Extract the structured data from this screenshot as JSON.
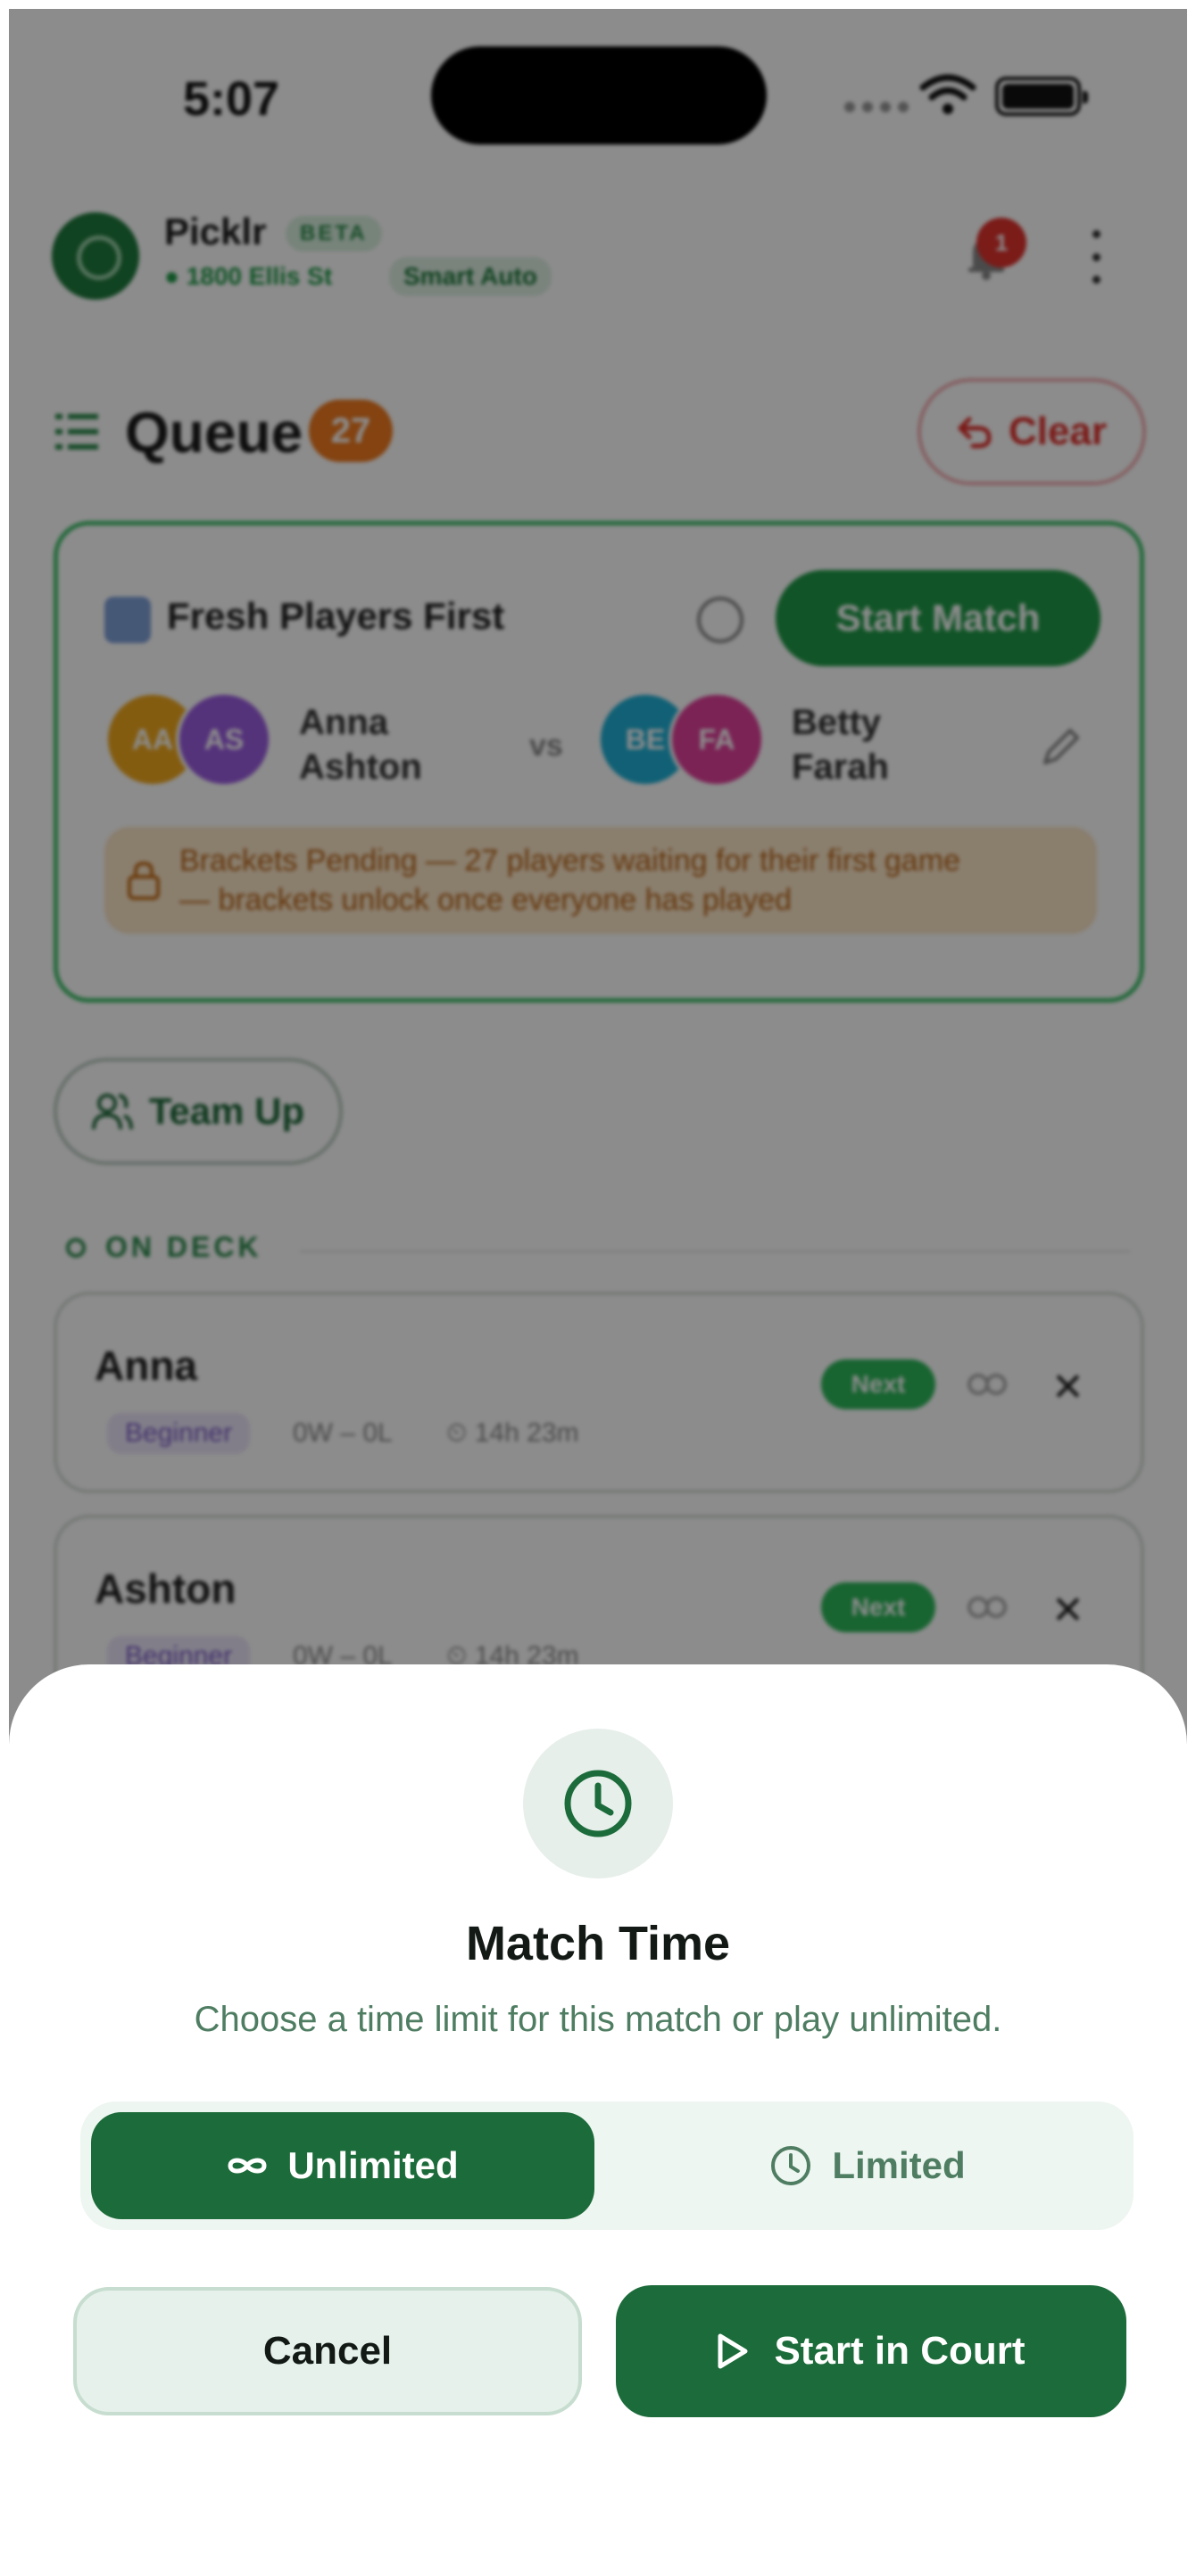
{
  "status_bar": {
    "time": "5:07"
  },
  "app": {
    "name": "Picklr",
    "badge": "BETA",
    "location": "1800 Ellis St",
    "mode": "Smart Auto",
    "notifications": "1"
  },
  "queue": {
    "title": "Queue",
    "count": "27",
    "clear_label": "Clear"
  },
  "next_match": {
    "mode_label": "Fresh Players First",
    "start_label": "Start Match",
    "vs": "vs",
    "team_a": {
      "players": [
        {
          "initials": "AA",
          "color": "#f0a81e"
        },
        {
          "initials": "AS",
          "color": "#9b5de0"
        }
      ],
      "name_line1": "Anna",
      "name_line2": "Ashton"
    },
    "team_b": {
      "players": [
        {
          "initials": "BE",
          "color": "#1fb0d6"
        },
        {
          "initials": "FA",
          "color": "#e0409a"
        }
      ],
      "name_line1": "Betty",
      "name_line2": "Farah"
    },
    "pending_line1": "Brackets Pending — 27 players waiting for their first game",
    "pending_line2": "— brackets unlock once everyone has played"
  },
  "team_up_label": "Team Up",
  "on_deck": {
    "label": "ON DECK",
    "players": [
      {
        "name": "Anna",
        "level": "Beginner",
        "record": "0W – 0L",
        "wait": "14h 23m",
        "badge": "Next"
      },
      {
        "name": "Ashton",
        "level": "Beginner",
        "record": "0W – 0L",
        "wait": "14h 23m",
        "badge": "Next"
      }
    ]
  },
  "sheet": {
    "icon": "clock-icon",
    "title": "Match Time",
    "subtitle": "Choose a time limit for this match or play unlimited.",
    "options": [
      {
        "label": "Unlimited",
        "icon": "infinity-icon",
        "selected": true
      },
      {
        "label": "Limited",
        "icon": "clock-icon",
        "selected": false
      }
    ],
    "cancel_label": "Cancel",
    "start_label": "Start in Court"
  },
  "colors": {
    "primary": "#1c6b3a",
    "accent_green": "#1f9a47",
    "danger": "#e0332e",
    "warning": "#f07a1f"
  }
}
